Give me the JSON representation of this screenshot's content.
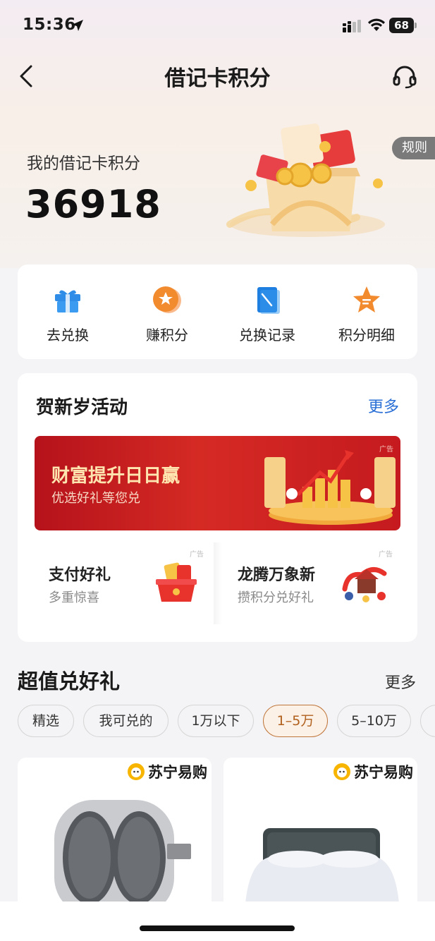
{
  "status_bar": {
    "time": "15:36",
    "battery": "68"
  },
  "nav": {
    "title": "借记卡积分"
  },
  "header": {
    "points_label": "我的借记卡积分",
    "points_value": "36918",
    "rules_label": "规则"
  },
  "quick_menu": [
    {
      "label": "去兑换",
      "icon": "gift-icon"
    },
    {
      "label": "赚积分",
      "icon": "coin-star-icon"
    },
    {
      "label": "兑换记录",
      "icon": "record-icon"
    },
    {
      "label": "积分明细",
      "icon": "star-detail-icon"
    }
  ],
  "activity": {
    "title": "贺新岁活动",
    "more": "更多",
    "banner": {
      "title": "财富提升日日赢",
      "subtitle": "优选好礼等您兑",
      "ad": "广告"
    },
    "promos": [
      {
        "title": "支付好礼",
        "desc": "多重惊喜",
        "ad": "广告"
      },
      {
        "title": "龙腾万象新",
        "desc": "攒积分兑好礼",
        "ad": "广告"
      }
    ]
  },
  "gifts": {
    "title": "超值兑好礼",
    "more": "更多",
    "filters": [
      "精选",
      "我可兑的",
      "1万以下",
      "1–5万",
      "5–10万"
    ],
    "active_filter": "1–5万",
    "products": [
      {
        "brand": "苏宁易购",
        "name_icon": "massager-image"
      },
      {
        "brand": "苏宁易购",
        "name_icon": "bed-image"
      }
    ]
  },
  "colors": {
    "accent_blue": "#2a6fd6",
    "chip_active": "#b0601c",
    "banner_red": "#c51a1f"
  }
}
